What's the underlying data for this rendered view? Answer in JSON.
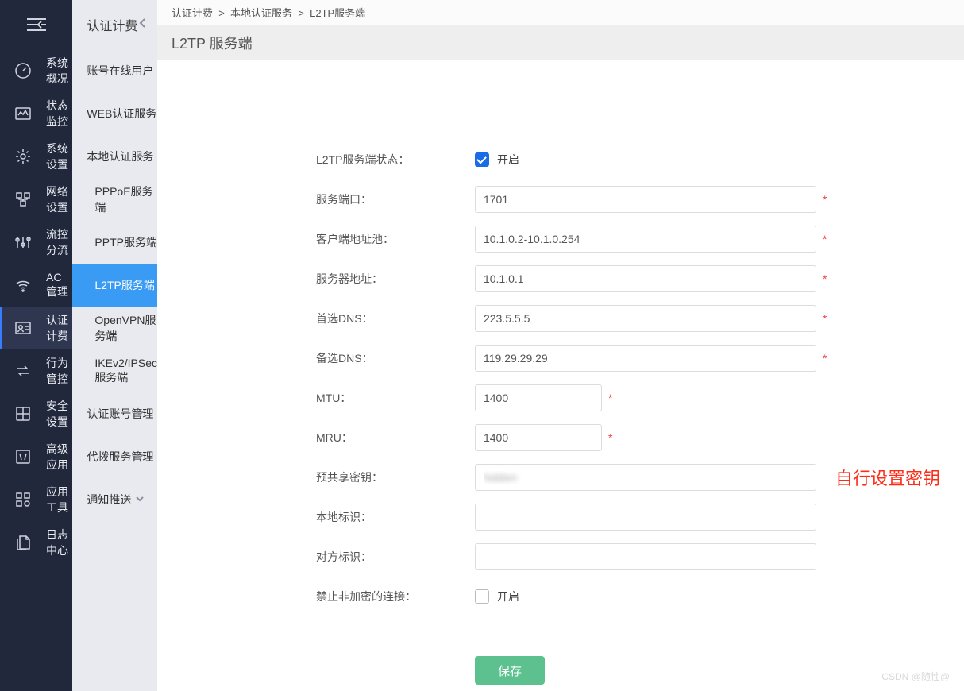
{
  "nav1": {
    "items": [
      {
        "label": "系统概况",
        "icon": "dashboard-icon"
      },
      {
        "label": "状态监控",
        "icon": "monitor-icon"
      },
      {
        "label": "系统设置",
        "icon": "gear-icon"
      },
      {
        "label": "网络设置",
        "icon": "network-icon"
      },
      {
        "label": "流控分流",
        "icon": "sliders-icon"
      },
      {
        "label": "AC管理",
        "icon": "wifi-icon"
      },
      {
        "label": "认证计费",
        "icon": "user-card-icon",
        "active": true
      },
      {
        "label": "行为管控",
        "icon": "swap-icon"
      },
      {
        "label": "安全设置",
        "icon": "shield-icon"
      },
      {
        "label": "高级应用",
        "icon": "app-icon"
      },
      {
        "label": "应用工具",
        "icon": "tools-icon"
      },
      {
        "label": "日志中心",
        "icon": "log-icon"
      }
    ]
  },
  "nav2": {
    "title": "认证计费",
    "items": [
      {
        "label": "账号在线用户",
        "type": "item"
      },
      {
        "label": "WEB认证服务",
        "type": "item"
      },
      {
        "label": "本地认证服务",
        "type": "group",
        "expanded": true,
        "children": [
          {
            "label": "PPPoE服务端"
          },
          {
            "label": "PPTP服务端"
          },
          {
            "label": "L2TP服务端",
            "active": true
          },
          {
            "label": "OpenVPN服务端"
          },
          {
            "label": "IKEv2/IPSec服务端"
          }
        ]
      },
      {
        "label": "认证账号管理",
        "type": "group",
        "expanded": false
      },
      {
        "label": "代拨服务管理",
        "type": "group",
        "expanded": false
      },
      {
        "label": "通知推送",
        "type": "group",
        "expanded": false
      }
    ]
  },
  "breadcrumb": [
    "认证计费",
    "本地认证服务",
    "L2TP服务端"
  ],
  "page_title": "L2TP 服务端",
  "form": {
    "status": {
      "label": "L2TP服务端状态：",
      "checkbox_label": "开启",
      "checked": true
    },
    "port": {
      "label": "服务端口：",
      "value": "1701",
      "required": true
    },
    "pool": {
      "label": "客户端地址池：",
      "value": "10.1.0.2-10.1.0.254",
      "required": true
    },
    "server": {
      "label": "服务器地址：",
      "value": "10.1.0.1",
      "required": true
    },
    "dns1": {
      "label": "首选DNS：",
      "value": "223.5.5.5",
      "required": true
    },
    "dns2": {
      "label": "备选DNS：",
      "value": "119.29.29.29",
      "required": true
    },
    "mtu": {
      "label": "MTU：",
      "value": "1400",
      "short": true,
      "required": true
    },
    "mru": {
      "label": "MRU：",
      "value": "1400",
      "short": true,
      "required": true
    },
    "psk": {
      "label": "预共享密钥：",
      "value": "hidden",
      "annotation": "自行设置密钥"
    },
    "localid": {
      "label": "本地标识：",
      "value": ""
    },
    "remoteid": {
      "label": "对方标识：",
      "value": ""
    },
    "noenc": {
      "label": "禁止非加密的连接：",
      "checkbox_label": "开启",
      "checked": false
    }
  },
  "save_label": "保存",
  "watermark": "CSDN @随性@"
}
